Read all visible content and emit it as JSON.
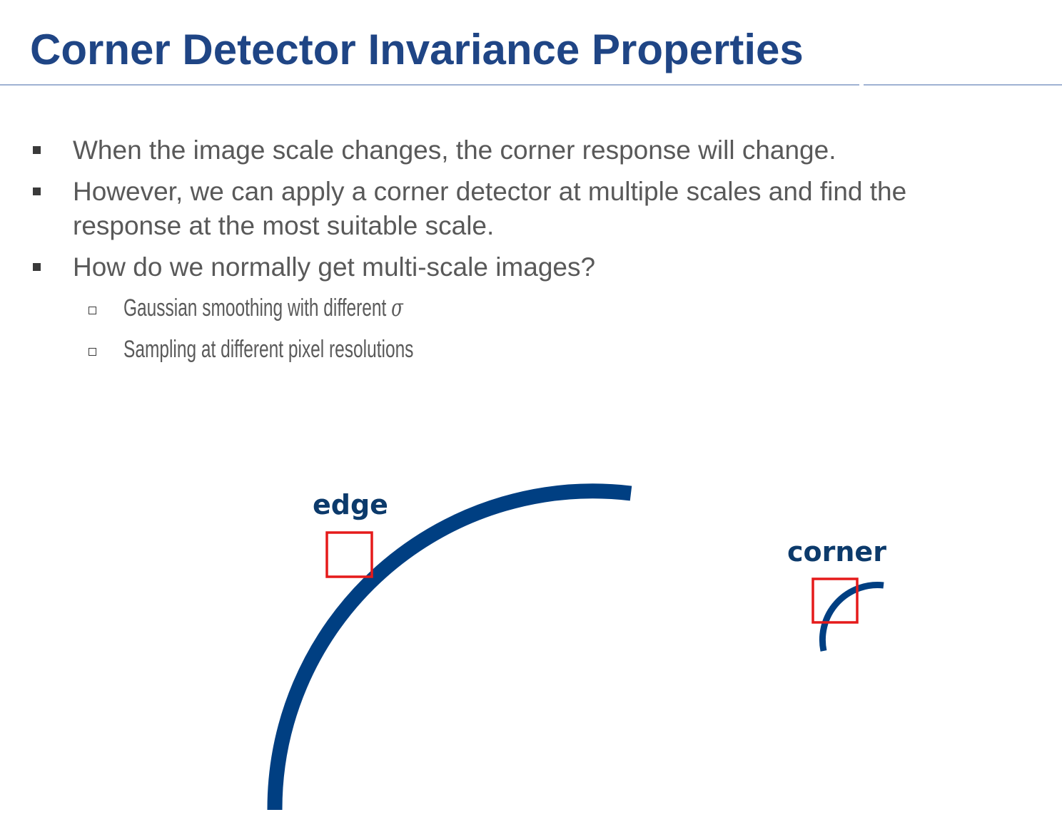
{
  "slide": {
    "title": "Corner Detector Invariance Properties",
    "bullets": [
      {
        "text": "When the image scale changes, the corner response will change."
      },
      {
        "text": "However, we can apply a corner detector at multiple scales and find the response at the most suitable scale."
      },
      {
        "text": "How do we normally get multi-scale images?"
      }
    ],
    "sub_bullets": [
      {
        "text": "Gaussian smoothing with different ",
        "symbol": "σ"
      },
      {
        "text": "Sampling at different pixel resolutions"
      }
    ]
  },
  "figure": {
    "edge_label": "edge",
    "corner_label": "corner",
    "colors": {
      "arc": "#003f82",
      "window": "#e51a1a",
      "label": "#0c3a6b"
    }
  }
}
